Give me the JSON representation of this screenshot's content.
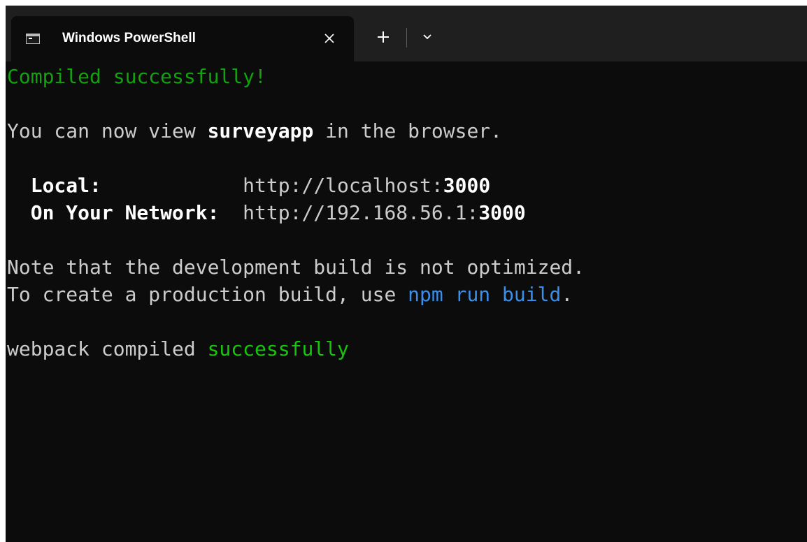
{
  "window": {
    "tab": {
      "title": "Windows PowerShell",
      "icon": "powershell-terminal-icon",
      "close_icon": "close-icon"
    },
    "new_tab_icon": "plus-icon",
    "dropdown_icon": "chevron-down-icon"
  },
  "colors": {
    "background": "#0c0c0c",
    "titlebar": "#1f1f1f",
    "text": "#cccccc",
    "green": "#13a10e",
    "bright_green": "#16c60c",
    "blue": "#3b8eea"
  },
  "terminal": {
    "compiled": "Compiled successfully!",
    "view_pre": "You can now view ",
    "app_name": "surveyapp",
    "view_post": " in the browser.",
    "local_label": "Local:",
    "local_url_prefix": "http://localhost:",
    "local_port": "3000",
    "network_label": "On Your Network:",
    "network_url_prefix": "http://192.168.56.1:",
    "network_port": "3000",
    "note_line": "Note that the development build is not optimized.",
    "prod_pre": "To create a production build, use ",
    "prod_cmd": "npm run build",
    "prod_post": ".",
    "webpack_pre": "webpack compiled ",
    "webpack_status": "successfully"
  }
}
